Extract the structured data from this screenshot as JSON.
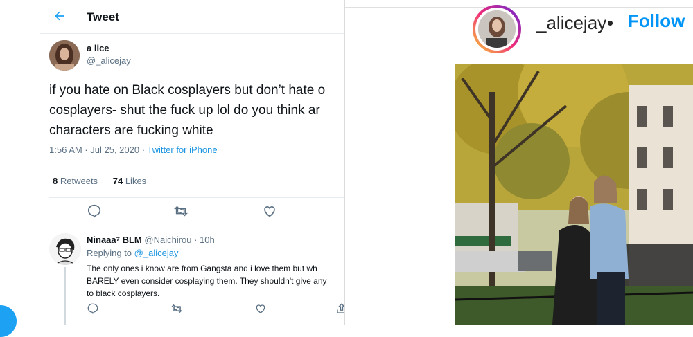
{
  "twitter": {
    "header_title": "Tweet",
    "author_name": "a lice",
    "author_handle": "@_alicejay",
    "tweet_text_lines": [
      "if you hate on Black cosplayers but don’t hate o",
      "cosplayers- shut the fuck up lol do you think ar",
      "characters are fucking white"
    ],
    "timestamp": "1:56 AM · Jul 25, 2020 ·",
    "source": "Twitter for iPhone",
    "retweet_count": "8",
    "retweets_label": "Retweets",
    "like_count": "74",
    "likes_label": "Likes",
    "reply": {
      "name": "Ninaaa⁷ BLM",
      "handle": "@Naichirou",
      "time": "· 10h",
      "replying_prefix": "Replying to",
      "replying_to": "@_alicejay",
      "text_lines": [
        "The only ones i know are from Gangsta and i love them but wh",
        "BARELY even consider cosplaying them. They shouldn't give any",
        "to black cosplayers."
      ]
    },
    "colors": {
      "accent": "#1da1f2",
      "link": "#1b95e0",
      "muted": "#5b7083"
    }
  },
  "instagram": {
    "username": "_alicejay",
    "dot": "•",
    "follow_label": "Follow",
    "colors": {
      "follow": "#0095f6"
    }
  }
}
